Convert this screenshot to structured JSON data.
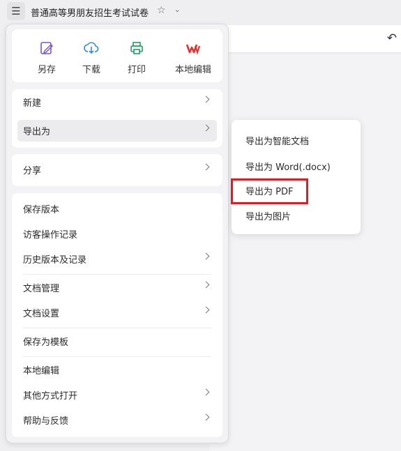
{
  "topbar": {
    "menu_icon": "hamburger-icon",
    "title": "普通高等男朋友招生考试试卷",
    "star_icon": "star-icon",
    "caret_icon": "chevron-down-icon",
    "undo_icon": "undo-icon"
  },
  "quick_actions": [
    {
      "label": "另存",
      "icon": "save-as-icon",
      "color": "#7b55c8"
    },
    {
      "label": "下载",
      "icon": "download-cloud-icon",
      "color": "#2d8cf0"
    },
    {
      "label": "打印",
      "icon": "printer-icon",
      "color": "#20a060"
    },
    {
      "label": "本地编辑",
      "icon": "wps-icon",
      "color": "#e8312f"
    }
  ],
  "menu": {
    "new": "新建",
    "export": "导出为",
    "share": "分享",
    "save_version": "保存版本",
    "visitor_log": "访客操作记录",
    "history": "历史版本及记录",
    "doc_manage": "文档管理",
    "doc_settings": "文档设置",
    "save_template": "保存为模板",
    "local_edit": "本地编辑",
    "open_other": "其他方式打开",
    "help": "帮助与反馈"
  },
  "export_submenu": {
    "smart_doc": "导出为智能文档",
    "word": "导出为 Word(.docx)",
    "pdf": "导出为 PDF",
    "image": "导出为图片"
  },
  "highlight_color": "#e01b24"
}
